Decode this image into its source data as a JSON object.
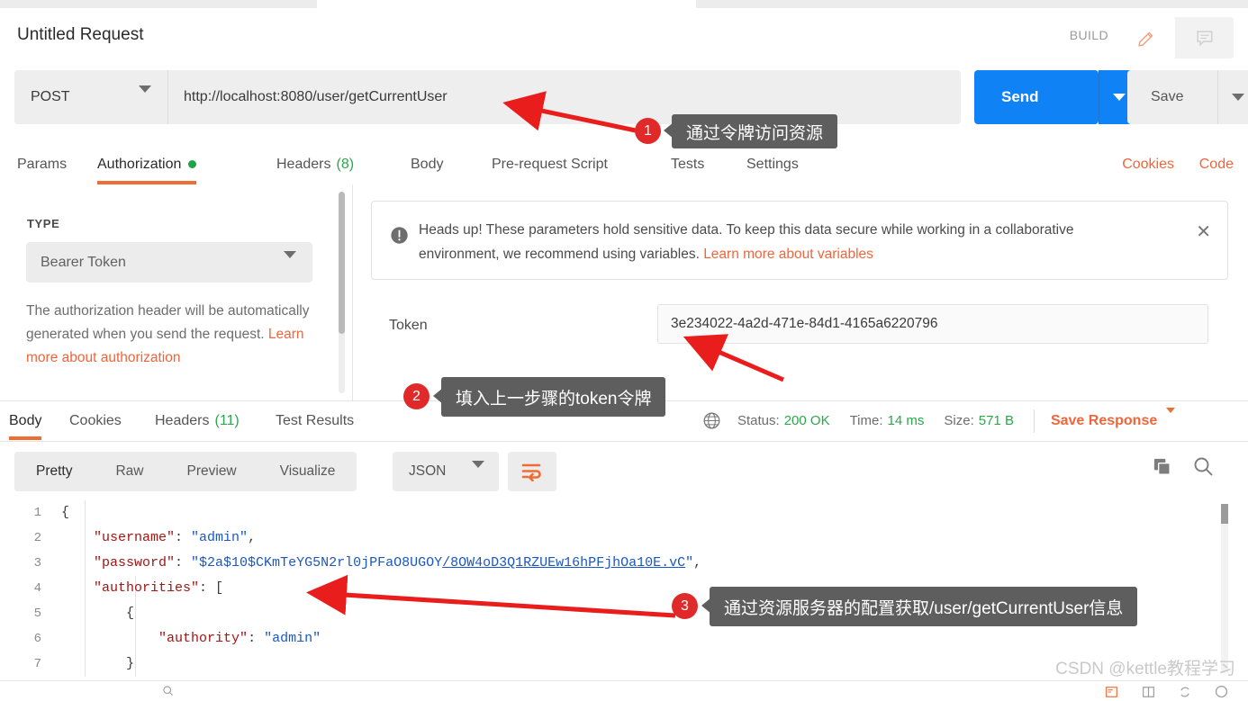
{
  "header": {
    "request_title": "Untitled Request",
    "build_label": "BUILD",
    "edit_icon": "pencil-icon",
    "comment_icon": "comment-icon"
  },
  "url_bar": {
    "method": "POST",
    "url": "http://localhost:8080/user/getCurrentUser",
    "send_label": "Send",
    "save_label": "Save"
  },
  "request_tabs": {
    "items": [
      {
        "label": "Params",
        "selected": false
      },
      {
        "label": "Authorization",
        "selected": true,
        "indicator": "green-dot"
      },
      {
        "label": "Headers",
        "count": "(8)",
        "selected": false
      },
      {
        "label": "Body",
        "selected": false
      },
      {
        "label": "Pre-request Script",
        "selected": false
      },
      {
        "label": "Tests",
        "selected": false
      },
      {
        "label": "Settings",
        "selected": false
      }
    ],
    "right_links": [
      {
        "label": "Cookies"
      },
      {
        "label": "Code"
      }
    ]
  },
  "authorization": {
    "type_label": "TYPE",
    "type_value": "Bearer Token",
    "description_text": "The authorization header will be automatically generated when you send the request. ",
    "description_link": "Learn more about authorization",
    "warning": {
      "text": "Heads up! These parameters hold sensitive data. To keep this data secure while working in a collaborative environment, we recommend using variables. ",
      "link": "Learn more about variables",
      "close_label": "✕",
      "icon": "exclamation-circle-icon"
    },
    "token_label": "Token",
    "token_value": "3e234022-4a2d-471e-84d1-4165a6220796"
  },
  "response": {
    "tabs": [
      {
        "label": "Body",
        "selected": true
      },
      {
        "label": "Cookies",
        "selected": false
      },
      {
        "label": "Headers",
        "count": "(11)",
        "selected": false
      },
      {
        "label": "Test Results",
        "selected": false
      }
    ],
    "meta": {
      "globe_icon": "globe-icon",
      "status_label": "Status:",
      "status_value": "200 OK",
      "time_label": "Time:",
      "time_value": "14 ms",
      "size_label": "Size:",
      "size_value": "571 B",
      "save_response_label": "Save Response"
    },
    "toolbar": {
      "views": [
        {
          "label": "Pretty",
          "selected": true
        },
        {
          "label": "Raw",
          "selected": false
        },
        {
          "label": "Preview",
          "selected": false
        },
        {
          "label": "Visualize",
          "selected": false
        }
      ],
      "format": "JSON",
      "wrap_icon": "word-wrap-icon",
      "copy_icon": "copy-icon",
      "search_icon": "search-icon"
    },
    "body_lines": [
      {
        "num": "1",
        "segments": [
          {
            "t": "{",
            "c": "p"
          }
        ]
      },
      {
        "num": "2",
        "segments": [
          {
            "t": "    ",
            "c": "p"
          },
          {
            "t": "\"username\"",
            "c": "k"
          },
          {
            "t": ": ",
            "c": "p"
          },
          {
            "t": "\"admin\"",
            "c": "s"
          },
          {
            "t": ",",
            "c": "p"
          }
        ]
      },
      {
        "num": "3",
        "segments": [
          {
            "t": "    ",
            "c": "p"
          },
          {
            "t": "\"password\"",
            "c": "k"
          },
          {
            "t": ": ",
            "c": "p"
          },
          {
            "t": "\"$2a$10$CKmTeYG5N2rl0jPFaO8UGOY",
            "c": "s"
          },
          {
            "t": "/8OW4oD3Q1RZUEw16hPFjhOa10E.vC",
            "c": "s underline"
          },
          {
            "t": "\"",
            "c": "s"
          },
          {
            "t": ",",
            "c": "p"
          }
        ]
      },
      {
        "num": "4",
        "segments": [
          {
            "t": "    ",
            "c": "p"
          },
          {
            "t": "\"authorities\"",
            "c": "k"
          },
          {
            "t": ": [",
            "c": "p"
          }
        ]
      },
      {
        "num": "5",
        "segments": [
          {
            "t": "        {",
            "c": "p"
          }
        ]
      },
      {
        "num": "6",
        "segments": [
          {
            "t": "            ",
            "c": "p"
          },
          {
            "t": "\"authority\"",
            "c": "k"
          },
          {
            "t": ": ",
            "c": "p"
          },
          {
            "t": "\"admin\"",
            "c": "s"
          }
        ]
      },
      {
        "num": "7",
        "segments": [
          {
            "t": "        }",
            "c": "p"
          }
        ]
      }
    ]
  },
  "annotations": [
    {
      "number": "1",
      "text": "通过令牌访问资源"
    },
    {
      "number": "2",
      "text": "填入上一步骤的token令牌"
    },
    {
      "number": "3",
      "text": "通过资源服务器的配置获取/user/getCurrentUser信息"
    }
  ],
  "watermark": "CSDN @kettle教程学习",
  "colors": {
    "accent_orange": "#ef6c34",
    "send_blue": "#0f82f5",
    "status_green": "#2aa84a",
    "annotation_red": "#e02a2a",
    "callout_gray": "#5e5e5e"
  }
}
